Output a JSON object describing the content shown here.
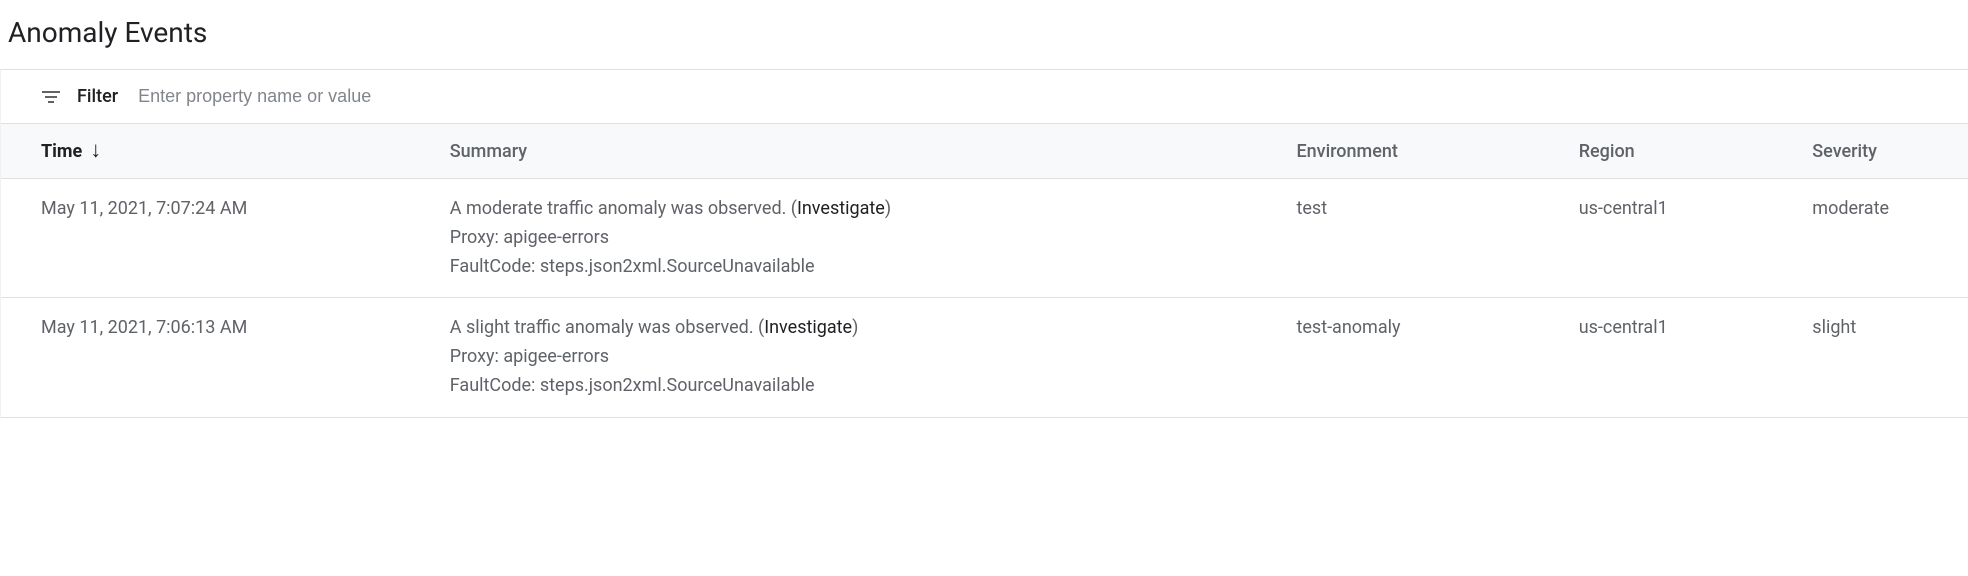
{
  "page": {
    "title": "Anomaly Events"
  },
  "filter": {
    "label": "Filter",
    "placeholder": "Enter property name or value"
  },
  "table": {
    "columns": {
      "time": "Time",
      "summary": "Summary",
      "environment": "Environment",
      "region": "Region",
      "severity": "Severity"
    },
    "rows": [
      {
        "time": "May 11, 2021, 7:07:24 AM",
        "summary_main": "A moderate traffic anomaly was observed. (",
        "summary_link": "Investigate",
        "summary_end": ")",
        "proxy_line": "Proxy: apigee-errors",
        "fault_line": "FaultCode: steps.json2xml.SourceUnavailable",
        "environment": "test",
        "region": "us-central1",
        "severity": "moderate"
      },
      {
        "time": "May 11, 2021, 7:06:13 AM",
        "summary_main": "A slight traffic anomaly was observed. (",
        "summary_link": "Investigate",
        "summary_end": ")",
        "proxy_line": "Proxy: apigee-errors",
        "fault_line": "FaultCode: steps.json2xml.SourceUnavailable",
        "environment": "test-anomaly",
        "region": "us-central1",
        "severity": "slight"
      }
    ]
  }
}
